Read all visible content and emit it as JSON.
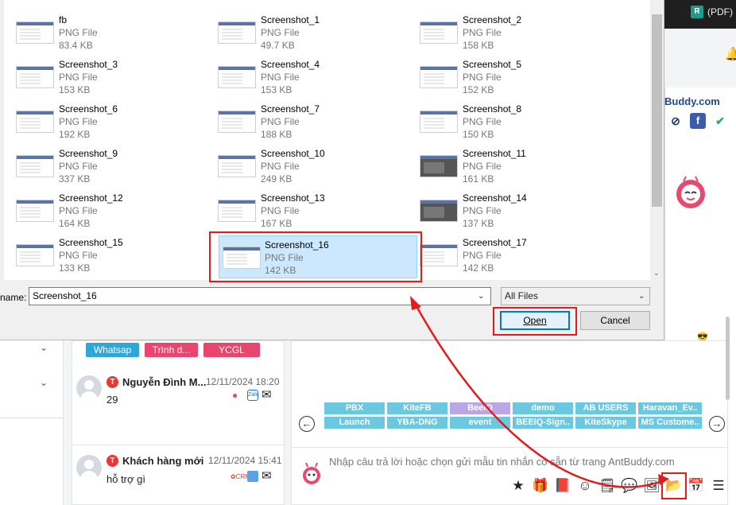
{
  "top_bar": {
    "badge": "R",
    "title": "(PDF) N"
  },
  "brand": "Buddy.com",
  "left_chevrons": [
    "⌄",
    "⌄"
  ],
  "tags": [
    "Whatsap",
    "Trình d...",
    "YCGL"
  ],
  "conversations": [
    {
      "badge": "T",
      "name": "Nguyễn Đình M...",
      "time": "12/11/2024 18:20",
      "message": "29"
    },
    {
      "badge": "T",
      "name": "Khách hàng mới",
      "time": "12/11/2024 15:41",
      "message": "hỗ trợ gì"
    }
  ],
  "quick_replies_row1": [
    "PBX",
    "KiteFB",
    "BeeIQ",
    "demo",
    "AB USERS",
    "Haravan_Ev.."
  ],
  "quick_replies_row2": [
    "Launch",
    "YBA-DNG",
    "event",
    "BEEIQ-Sign..",
    "KiteSkype",
    "MS Custome.."
  ],
  "composer_placeholder": "Nhập câu trả lời hoặc chọn gửi mẫu tin nhắn có sẵn từ trang AntBuddy.com",
  "colors": {
    "accent": "#e21b1b",
    "quick_reply": "#6cc7e0",
    "quick_reply_selected": "#b9a7e8",
    "dialog_selection": "#cce8ff"
  },
  "dialog": {
    "files": [
      {
        "name": "fb",
        "type": "PNG File",
        "size": "83.4 KB"
      },
      {
        "name": "Screenshot_1",
        "type": "PNG File",
        "size": "49.7 KB"
      },
      {
        "name": "Screenshot_2",
        "type": "PNG File",
        "size": "158 KB"
      },
      {
        "name": "Screenshot_3",
        "type": "PNG File",
        "size": "153 KB"
      },
      {
        "name": "Screenshot_4",
        "type": "PNG File",
        "size": "153 KB"
      },
      {
        "name": "Screenshot_5",
        "type": "PNG File",
        "size": "152 KB"
      },
      {
        "name": "Screenshot_6",
        "type": "PNG File",
        "size": "192 KB"
      },
      {
        "name": "Screenshot_7",
        "type": "PNG File",
        "size": "188 KB"
      },
      {
        "name": "Screenshot_8",
        "type": "PNG File",
        "size": "150 KB"
      },
      {
        "name": "Screenshot_9",
        "type": "PNG File",
        "size": "337 KB"
      },
      {
        "name": "Screenshot_10",
        "type": "PNG File",
        "size": "249 KB"
      },
      {
        "name": "Screenshot_11",
        "type": "PNG File",
        "size": "161 KB"
      },
      {
        "name": "Screenshot_12",
        "type": "PNG File",
        "size": "164 KB"
      },
      {
        "name": "Screenshot_13",
        "type": "PNG File",
        "size": "167 KB"
      },
      {
        "name": "Screenshot_14",
        "type": "PNG File",
        "size": "137 KB"
      },
      {
        "name": "Screenshot_15",
        "type": "PNG File",
        "size": "133 KB"
      },
      {
        "name": "Screenshot_16",
        "type": "PNG File",
        "size": "142 KB",
        "selected": true
      },
      {
        "name": "Screenshot_17",
        "type": "PNG File",
        "size": "142 KB"
      }
    ],
    "filename_label": "name:",
    "filename_value": "Screenshot_16",
    "filter": "All Files",
    "open_label": "Open",
    "cancel_label": "Cancel"
  }
}
